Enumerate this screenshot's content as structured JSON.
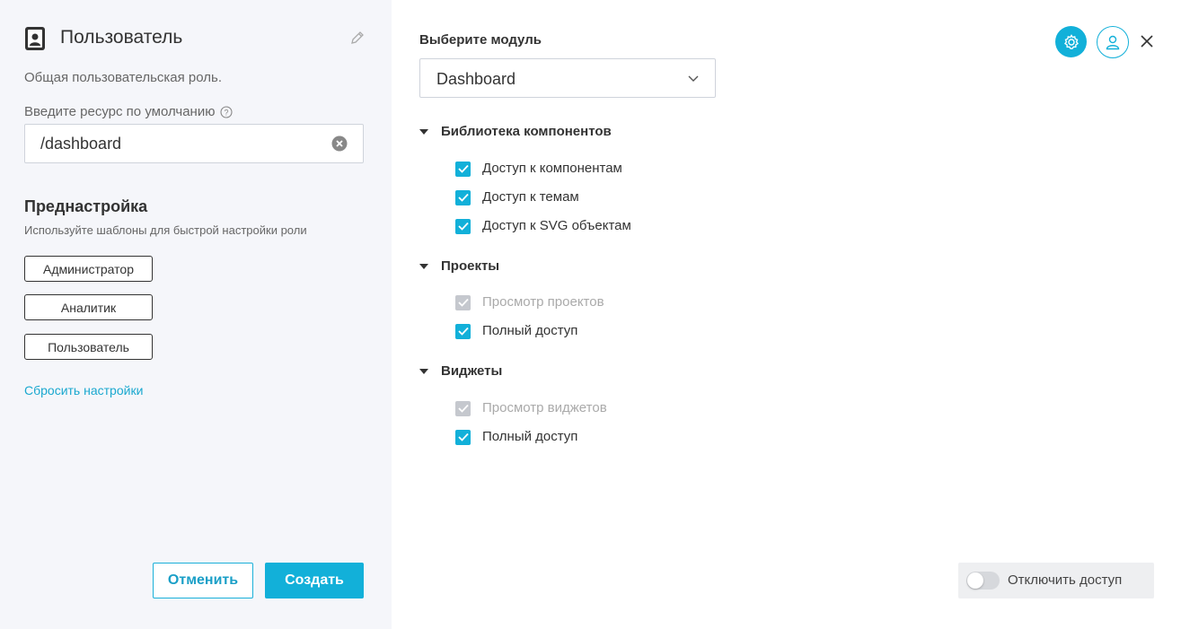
{
  "left_panel": {
    "title": "Пользователь",
    "description": "Общая пользовательская роль.",
    "resource_label": "Введите ресурс по умолчанию",
    "resource_value": "/dashboard",
    "preset_title": "Преднастройка",
    "preset_description": "Используйте шаблоны для быстрой настройки роли",
    "presets": [
      "Администратор",
      "Аналитик",
      "Пользователь"
    ],
    "reset_link": "Сбросить настройки",
    "cancel_label": "Отменить",
    "create_label": "Создать"
  },
  "right_panel": {
    "module_label": "Выберите модуль",
    "module_value": "Dashboard",
    "sections": [
      {
        "label": "Библиотека компонентов",
        "items": [
          {
            "label": "Доступ к компонентам",
            "checked": true,
            "disabled": false
          },
          {
            "label": "Доступ к темам",
            "checked": true,
            "disabled": false
          },
          {
            "label": "Доступ к SVG объектам",
            "checked": true,
            "disabled": false
          }
        ]
      },
      {
        "label": "Проекты",
        "items": [
          {
            "label": "Просмотр проектов",
            "checked": true,
            "disabled": true
          },
          {
            "label": "Полный доступ",
            "checked": true,
            "disabled": false
          }
        ]
      },
      {
        "label": "Виджеты",
        "items": [
          {
            "label": "Просмотр виджетов",
            "checked": true,
            "disabled": true
          },
          {
            "label": "Полный доступ",
            "checked": true,
            "disabled": false
          }
        ]
      }
    ],
    "toggle_label": "Отключить доступ",
    "toggle_on": false
  },
  "colors": {
    "accent": "#12b0d9",
    "left_bg": "#f5f6fa",
    "disabled": "#c5c8ce"
  }
}
